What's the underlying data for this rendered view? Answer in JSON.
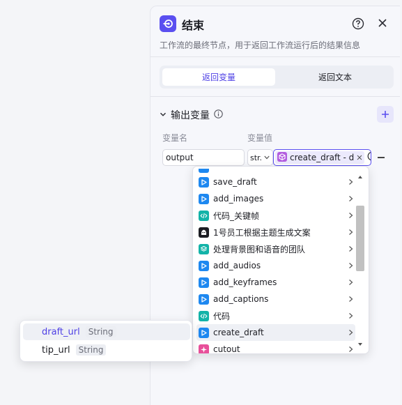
{
  "panel": {
    "title": "结束",
    "description": "工作流的最终节点，用于返回工作流运行后的结果信息",
    "tabs": [
      {
        "label": "返回变量",
        "active": true
      },
      {
        "label": "返回文本",
        "active": false
      }
    ],
    "output_section": {
      "title": "输出变量",
      "col_name": "变量名",
      "col_value": "变量值",
      "row": {
        "name": "output",
        "type": "str.",
        "value": "create_draft - d"
      }
    }
  },
  "dropdown": {
    "items": [
      {
        "label": "save_draft",
        "icon": "play-icon",
        "color": "#1e88f0"
      },
      {
        "label": "add_images",
        "icon": "play-icon",
        "color": "#1e88f0"
      },
      {
        "label": "代码_关键帧",
        "icon": "code-icon",
        "color": "#13b3a8"
      },
      {
        "label": "1号员工根据主题生成文案",
        "icon": "bot-icon",
        "color": "#1c1d23"
      },
      {
        "label": "处理背景图和语音的团队",
        "icon": "layers-icon",
        "color": "#13b3a8"
      },
      {
        "label": "add_audios",
        "icon": "play-icon",
        "color": "#1e88f0"
      },
      {
        "label": "add_keyframes",
        "icon": "play-icon",
        "color": "#1e88f0"
      },
      {
        "label": "add_captions",
        "icon": "play-icon",
        "color": "#1e88f0"
      },
      {
        "label": "代码",
        "icon": "code-icon",
        "color": "#13b3a8"
      },
      {
        "label": "create_draft",
        "icon": "play-icon",
        "color": "#1e88f0",
        "highlighted": true
      },
      {
        "label": "cutout",
        "icon": "sparkle-icon",
        "color": "#e8509a"
      }
    ]
  },
  "subpopup": {
    "items": [
      {
        "name": "draft_url",
        "type": "String",
        "highlighted": true
      },
      {
        "name": "tip_url",
        "type": "String"
      }
    ]
  },
  "colors": {
    "accent": "#5a4ff0",
    "accent_text": "#4e40e5"
  }
}
